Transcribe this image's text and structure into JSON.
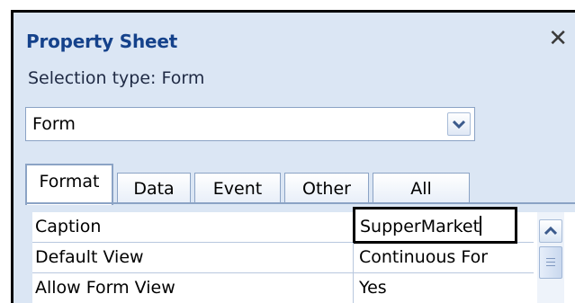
{
  "pane": {
    "title": "Property Sheet",
    "selection_type": "Selection type:  Form"
  },
  "selector": {
    "value": "Form"
  },
  "tabs": [
    {
      "label": "Format",
      "active": true
    },
    {
      "label": "Data",
      "active": false
    },
    {
      "label": "Event",
      "active": false
    },
    {
      "label": "Other",
      "active": false
    },
    {
      "label": "All",
      "active": false
    }
  ],
  "properties": [
    {
      "name": "Caption",
      "value": "SupperMarket"
    },
    {
      "name": "Default View",
      "value": "Continuous For"
    },
    {
      "name": "Allow Form View",
      "value": "Yes"
    }
  ],
  "icons": {
    "close": "close-icon",
    "dropdown": "chevron-down-icon",
    "scroll_up": "scroll-up-arrow-icon"
  },
  "colors": {
    "pane_background": "#dbe6f4",
    "title_text": "#15428b",
    "border_accent": "#8ba3c5"
  }
}
